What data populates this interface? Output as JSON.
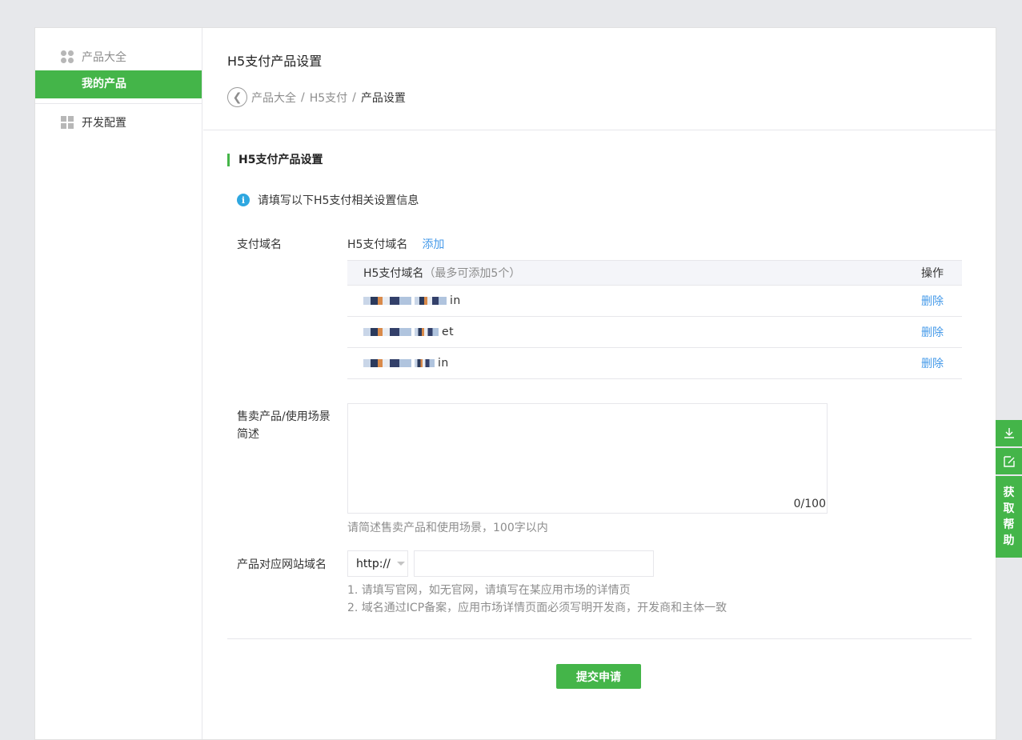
{
  "sidebar": {
    "group1_label": "产品大全",
    "active_item": "我的产品",
    "group2_label": "开发配置"
  },
  "main": {
    "title": "H5支付产品设置",
    "breadcrumb": [
      "产品大全",
      "H5支付",
      "产品设置"
    ],
    "breadcrumb_sep": "/",
    "section_title": "H5支付产品设置",
    "notice": "请填写以下H5支付相关设置信息",
    "domain": {
      "label": "支付域名",
      "head_label": "H5支付域名",
      "add_label": "添加",
      "table_header": "H5支付域名",
      "table_header_hint": "（最多可添加5个）",
      "table_action_header": "操作",
      "rows": [
        {
          "name_tail": "in",
          "action": "删除"
        },
        {
          "name_tail": "et",
          "action": "删除"
        },
        {
          "name_tail": "in",
          "action": "删除"
        }
      ]
    },
    "scene": {
      "label_line1": "售卖产品/使用场景",
      "label_line2": "简述",
      "value": "",
      "counter": "0/100",
      "help": "请简述售卖产品和使用场景，100字以内"
    },
    "website": {
      "label": "产品对应网站域名",
      "protocol": "http://",
      "value": "",
      "tip1": "1. 请填写官网，如无官网，请填写在某应用市场的详情页",
      "tip2": "2. 域名通过ICP备案，应用市场详情页面必须写明开发商，开发商和主体一致"
    },
    "submit_label": "提交申请"
  },
  "float_bar": {
    "help_chars": [
      "获",
      "取",
      "帮",
      "助"
    ]
  },
  "colors": {
    "accent": "#44b549",
    "link": "#459ae9",
    "info": "#2ea7e0"
  },
  "icons": {
    "group1": "dots-icon",
    "group2": "grid-icon",
    "back": "chevron-left-icon",
    "info": "info-icon",
    "download": "download-icon",
    "edit": "edit-icon"
  }
}
